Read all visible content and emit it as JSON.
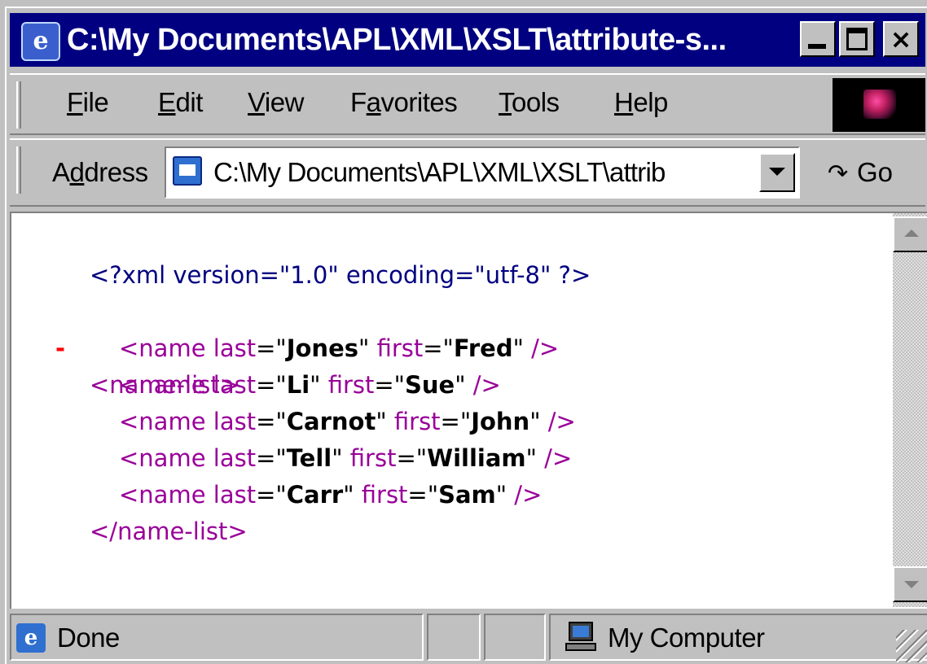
{
  "window": {
    "title": "C:\\My Documents\\APL\\XML\\XSLT\\attribute-s...",
    "buttons": {
      "minimize": "",
      "maximize": "",
      "close": "×"
    },
    "title_bar_color": "#000080"
  },
  "menu": {
    "items": [
      {
        "label": "File",
        "accel": "F",
        "rest": "ile"
      },
      {
        "label": "Edit",
        "accel": "E",
        "rest": "dit"
      },
      {
        "label": "View",
        "accel": "V",
        "rest": "iew"
      },
      {
        "label": "Favorites",
        "pre": "F",
        "accel": "a",
        "rest": "vorites"
      },
      {
        "label": "Tools",
        "accel": "T",
        "rest": "ools"
      },
      {
        "label": "Help",
        "accel": "H",
        "rest": "elp"
      }
    ]
  },
  "address": {
    "label_pre": "A",
    "label_accel": "d",
    "label_rest": "dress",
    "value": "C:\\My Documents\\APL\\XML\\XSLT\\attrib",
    "go_label": "Go",
    "go_icon": "go-arrow-icon"
  },
  "xml": {
    "declaration": "<?xml version=\"1.0\" encoding=\"utf-8\" ?>",
    "collapse_marker": "-",
    "root_open": "<name-list>",
    "root_close": "</name-list>",
    "entries": [
      {
        "last": "Jones",
        "first": "Fred"
      },
      {
        "last": "Li",
        "first": "Sue"
      },
      {
        "last": "Carnot",
        "first": "John"
      },
      {
        "last": "Tell",
        "first": "William"
      },
      {
        "last": "Carr",
        "first": "Sam"
      }
    ],
    "colors": {
      "declaration": "#000080",
      "markup": "#990099",
      "value": "#000000",
      "collapse": "#ff0000"
    }
  },
  "status": {
    "text": "Done",
    "zone": "My Computer"
  }
}
